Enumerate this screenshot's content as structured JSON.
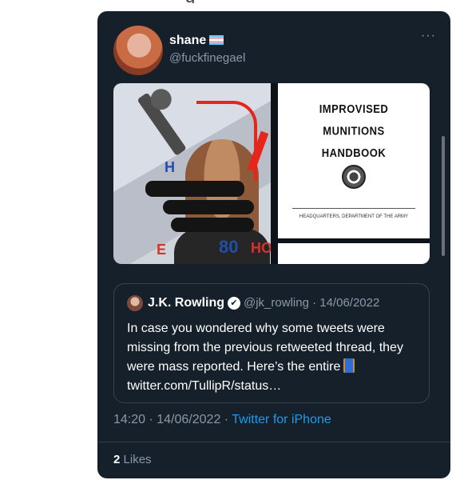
{
  "top_text": "g",
  "tweet": {
    "display_name": "shane",
    "handle": "@fuckfinegael",
    "more_label": "···",
    "media": {
      "photo_signs": [
        "H",
        "80",
        "E",
        "HO"
      ],
      "book": {
        "title": "IMPROVISED\nMUNITIONS\nHANDBOOK",
        "small_text": "HEADQUARTERS, DEPARTMENT OF THE ARMY"
      }
    },
    "quoted": {
      "display_name": "J.K. Rowling",
      "verified_icon": "✔",
      "meta": "@jk_rowling · 14/06/2022",
      "text": "In case you wondered why some tweets were missing from the previous retweeted thread, they were mass reported. Here’s the entire",
      "link": "twitter.com/TullipR/status…"
    },
    "time": "14:20 · 14/06/2022 · ",
    "source": "Twitter for iPhone",
    "likes_count": "2",
    "likes_label": "Likes"
  },
  "colors": {
    "card_bg": "#15202b",
    "accent": "#1d9bf0",
    "muted": "#8b98a5"
  }
}
